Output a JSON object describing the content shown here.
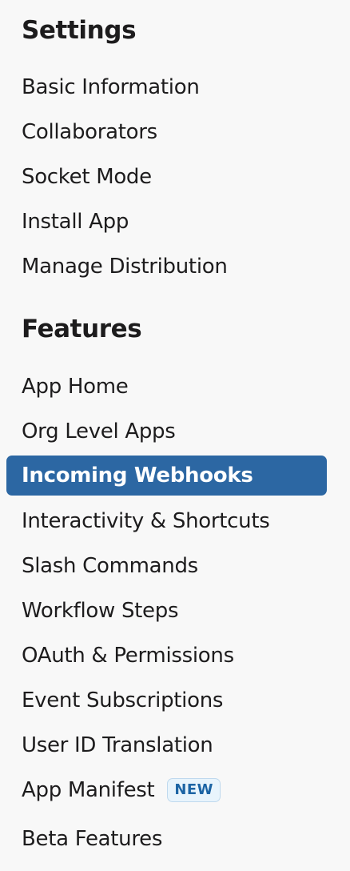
{
  "settings": {
    "heading": "Settings",
    "items": [
      {
        "label": "Basic Information"
      },
      {
        "label": "Collaborators"
      },
      {
        "label": "Socket Mode"
      },
      {
        "label": "Install App"
      },
      {
        "label": "Manage Distribution"
      }
    ]
  },
  "features": {
    "heading": "Features",
    "items": [
      {
        "label": "App Home"
      },
      {
        "label": "Org Level Apps"
      },
      {
        "label": "Incoming Webhooks",
        "active": true
      },
      {
        "label": "Interactivity & Shortcuts"
      },
      {
        "label": "Slash Commands"
      },
      {
        "label": "Workflow Steps"
      },
      {
        "label": "OAuth & Permissions"
      },
      {
        "label": "Event Subscriptions"
      },
      {
        "label": "User ID Translation"
      },
      {
        "label": "App Manifest",
        "badge": "NEW"
      },
      {
        "label": "Beta Features"
      }
    ]
  },
  "colors": {
    "active_background": "#2c67a3",
    "active_text": "#ffffff",
    "badge_text": "#1c64a4",
    "badge_background": "#e8f4fc",
    "sidebar_background": "#f8f8f8"
  }
}
